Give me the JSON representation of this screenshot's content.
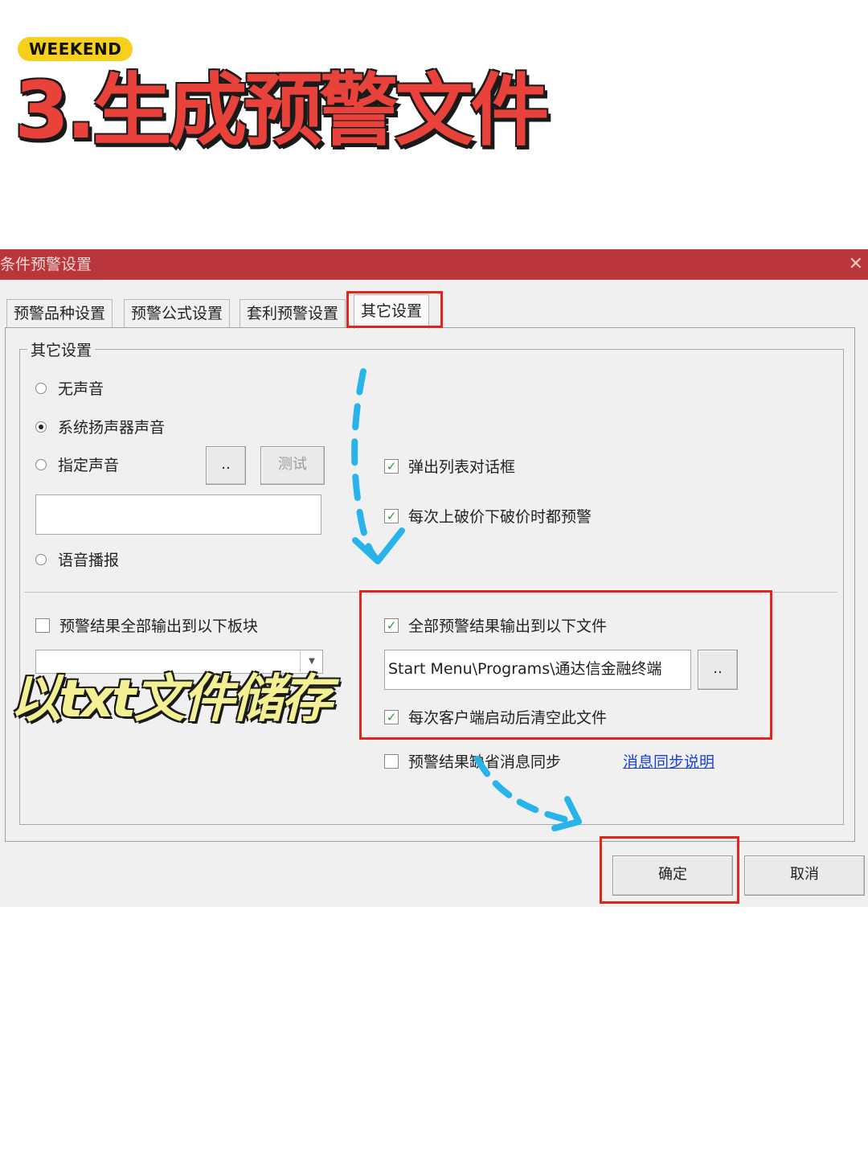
{
  "header": {
    "badge": "WEEKEND",
    "title": "3.生成预警文件"
  },
  "dialog": {
    "title": "条件预警设置",
    "close_glyph": "✕",
    "tabs": [
      {
        "label": "预警品种设置"
      },
      {
        "label": "预警公式设置"
      },
      {
        "label": "套利预警设置"
      },
      {
        "label": "其它设置"
      }
    ],
    "group_title": "其它设置",
    "radios": {
      "no_sound": "无声音",
      "system_speaker": "系统扬声器声音",
      "custom_sound": "指定声音",
      "voice": "语音播报"
    },
    "browse_label": "..",
    "test_label": "测试",
    "checks": {
      "popup_list": "弹出列表对话框",
      "every_break": "每次上破价下破价时都预警",
      "output_block": "预警结果全部输出到以下板块",
      "output_file": "全部预警结果输出到以下文件",
      "clear_file": "每次客户端启动后清空此文件",
      "sync_msg": "预警结果缺省消息同步"
    },
    "file_path": "Start Menu\\Programs\\通达信金融终端",
    "sync_link": "消息同步说明",
    "ok": "确定",
    "cancel": "取消"
  },
  "annotation": {
    "overlay": "以txt文件储存"
  },
  "colors": {
    "titlebar": "#b9373a",
    "highlight": "#e3241c",
    "arrow": "#28b4ea",
    "title_red": "#e8423b",
    "badge": "#f7cf1d"
  }
}
